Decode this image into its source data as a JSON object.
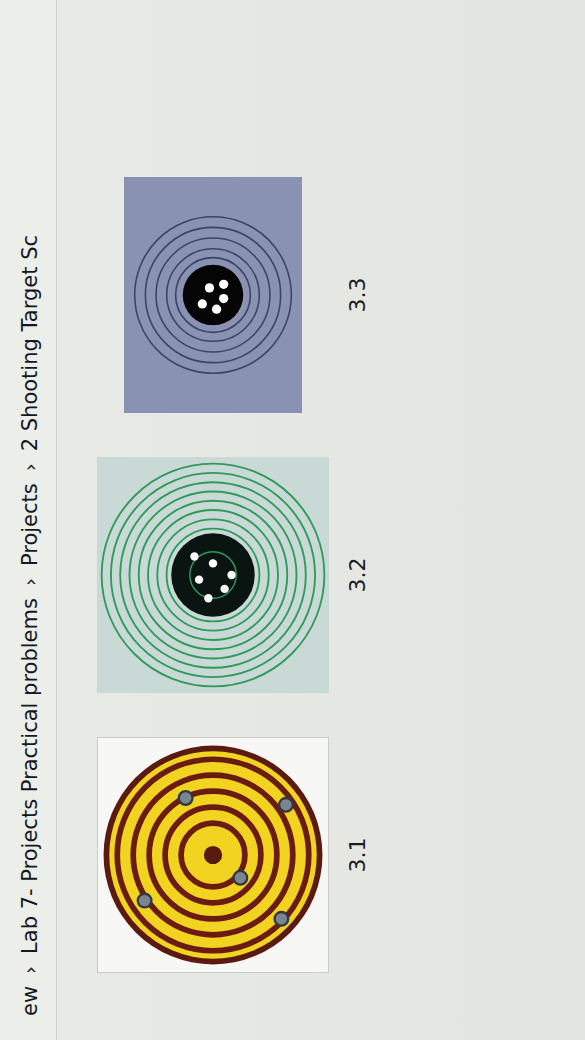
{
  "breadcrumb": {
    "separator": "›",
    "items": [
      "ew",
      "Lab 7- Projects Practical problems",
      "Projects",
      "2 Shooting Target Sc"
    ]
  },
  "thumbnails": [
    {
      "label": "3.1",
      "kind": "yellow-rings"
    },
    {
      "label": "3.2",
      "kind": "green-rings"
    },
    {
      "label": "3.3",
      "kind": "dark-rings"
    }
  ]
}
